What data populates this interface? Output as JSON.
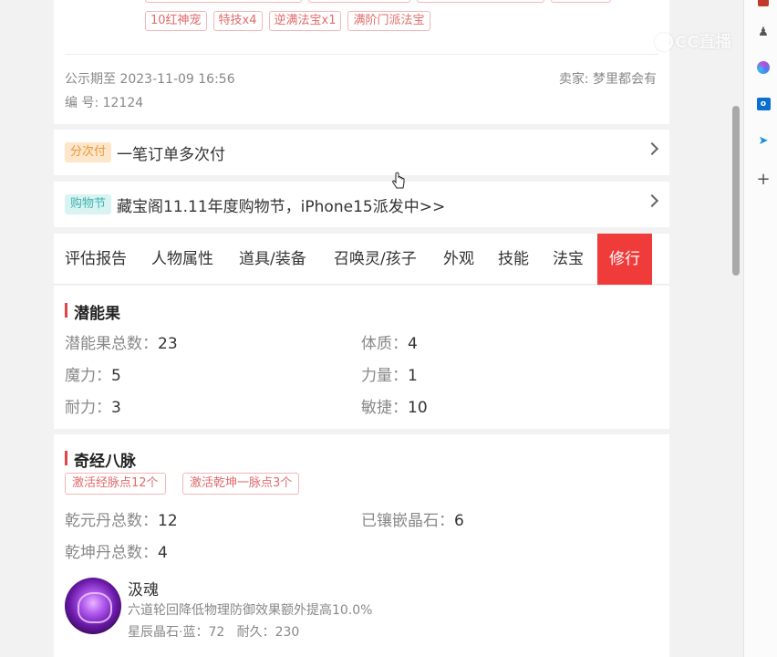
{
  "listing": {
    "tags": [
      "10红神宠",
      "特技x4",
      "逆满法宝x1",
      "满阶门派法宝"
    ],
    "publish_label": "公示期至 2023-11-09 16:56",
    "seller_label": "卖家: 梦里都会有",
    "serial_label": "编 号: 12124"
  },
  "installment": {
    "badge": "分次付",
    "text": "一笔订单多次付"
  },
  "promo": {
    "badge": "购物节",
    "text": "藏宝阁11.11年度购物节，iPhone15派发中>>"
  },
  "tabs": [
    "评估报告",
    "人物属性",
    "道具/装备",
    "召唤灵/孩子",
    "外观",
    "技能",
    "法宝",
    "修行"
  ],
  "potential": {
    "title": "潜能果",
    "items": [
      {
        "k": "潜能果总数：",
        "v": "23"
      },
      {
        "k": "体质：",
        "v": "4"
      },
      {
        "k": "魔力：",
        "v": "5"
      },
      {
        "k": "力量：",
        "v": "1"
      },
      {
        "k": "耐力：",
        "v": "3"
      },
      {
        "k": "敏捷：",
        "v": "10"
      }
    ]
  },
  "meridian": {
    "title": "奇经八脉",
    "tags": [
      "激活经脉点12个",
      "激活乾坤一脉点3个"
    ],
    "items": [
      {
        "k": "乾元丹总数：",
        "v": "12"
      },
      {
        "k": "已镶嵌晶石：",
        "v": "6"
      },
      {
        "k": "乾坤丹总数：",
        "v": "4"
      }
    ],
    "stone": {
      "name": "汲魂",
      "desc": "六道轮回降低物理防御效果额外提高10.0%",
      "detail": "星辰晶石·蓝：72   耐久：230"
    }
  },
  "watermark": "CC直播"
}
